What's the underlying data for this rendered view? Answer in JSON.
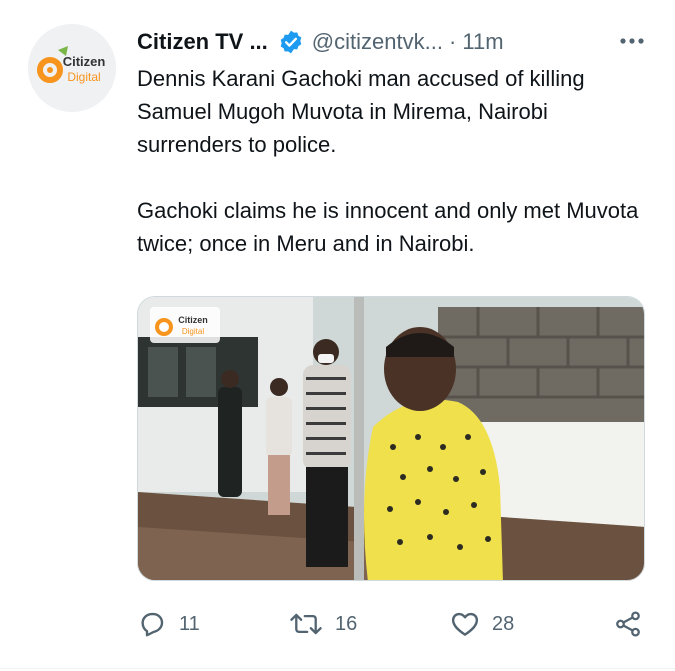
{
  "tweet": {
    "author_name": "Citizen TV ...",
    "handle": "@citizentvk...",
    "time": "· 11m",
    "avatar_text_top": "Citizen",
    "avatar_text_bottom": "Digital",
    "paragraphs": [
      "Dennis Karani Gachoki man accused of killing Samuel Mugoh Muvota in Mirema, Nairobi surrenders to police.",
      "Gachoki claims he is innocent and only met Muvota twice; once in Meru and in Nairobi."
    ],
    "media_watermark_top": "Citizen",
    "media_watermark_bottom": "Digital"
  },
  "actions": {
    "replies": "11",
    "retweets": "16",
    "likes": "28"
  },
  "icons": [
    "verified-badge-icon",
    "more-options-icon",
    "reply-icon",
    "retweet-icon",
    "like-icon",
    "share-icon"
  ],
  "colors": {
    "verified": "#1d9bf0",
    "secondary_text": "#536471",
    "brand_orange": "#f7941d",
    "brand_green": "#7ab648"
  }
}
